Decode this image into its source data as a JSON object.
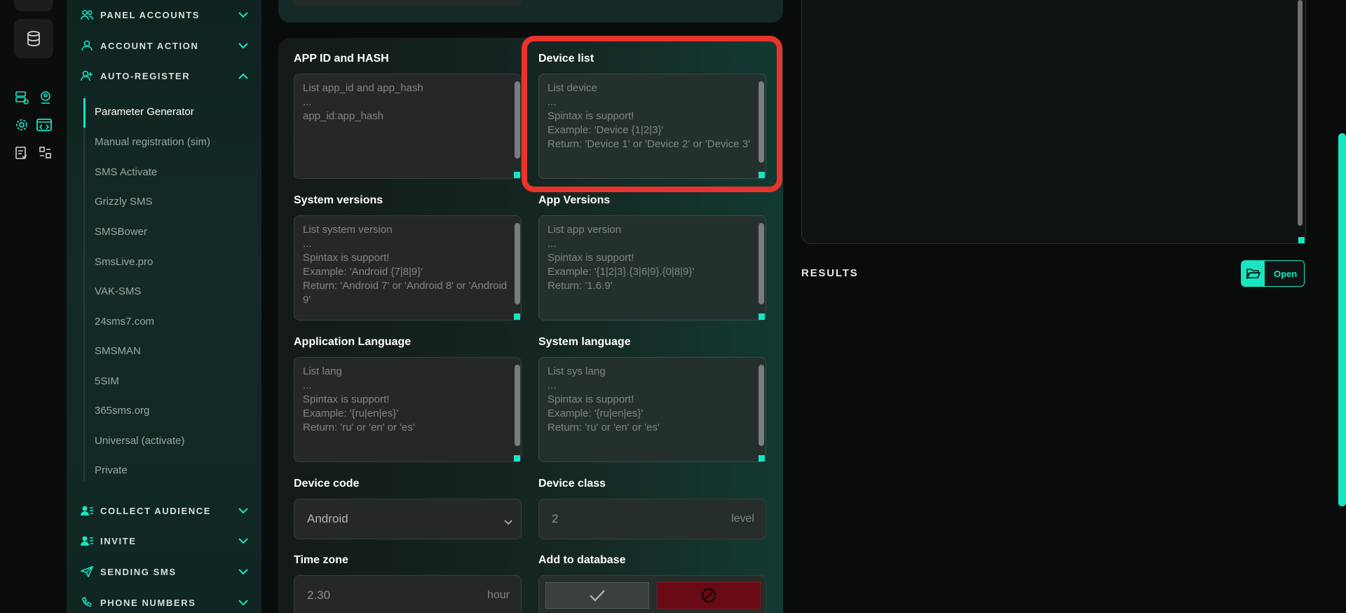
{
  "sidebar": {
    "sections": {
      "panel_accounts": "PANEL ACCOUNTS",
      "account_action": "ACCOUNT ACTION",
      "auto_register": "AUTO-REGISTER",
      "collect_audience": "COLLECT AUDIENCE",
      "invite": "INVITE",
      "sending_sms": "SENDING SMS",
      "phone_numbers": "PHONE NUMBERS"
    },
    "items": [
      "Parameter Generator",
      "Manual registration (sim)",
      "SMS Activate",
      "Grizzly SMS",
      "SMSBower",
      "SmsLive.pro",
      "VAK-SMS",
      "24sms7.com",
      "SMSMAN",
      "5SIM",
      "365sms.org",
      "Universal (activate)",
      "Private"
    ]
  },
  "form": {
    "app_id": {
      "label": "APP ID and HASH",
      "placeholder": "List app_id and app_hash\n...\napp_id:app_hash"
    },
    "device_list": {
      "label": "Device list",
      "placeholder": "List device\n...\nSpintax is support!\nExample: 'Device {1|2|3}'\nReturn: 'Device 1' or 'Device 2' or 'Device 3'"
    },
    "system_versions": {
      "label": "System versions",
      "placeholder": "List system version\n...\nSpintax is support!\nExample: 'Android {7|8|9}'\nReturn: 'Android 7' or 'Android 8' or 'Android 9'"
    },
    "app_versions": {
      "label": "App Versions",
      "placeholder": "List app version\n...\nSpintax is support!\nExample: '{1|2|3}.{3|6|9}.{0|8|9}'\nReturn: '1.6.9'"
    },
    "app_language": {
      "label": "Application Language",
      "placeholder": "List lang\n...\nSpintax is support!\nExample: '{ru|en|es}'\nReturn: 'ru' or 'en' or 'es'"
    },
    "system_language": {
      "label": "System language",
      "placeholder": "List sys lang\n...\nSpintax is support!\nExample: '{ru|en|es}'\nReturn: 'ru' or 'en' or 'es'"
    },
    "device_code": {
      "label": "Device code",
      "value": "Android"
    },
    "device_class": {
      "label": "Device class",
      "value": "2",
      "unit": "level"
    },
    "time_zone": {
      "label": "Time zone",
      "value": "2.30",
      "unit": "hour"
    },
    "add_to_database": {
      "label": "Add to database"
    }
  },
  "results": {
    "title": "RESULTS",
    "open_label": "Open"
  },
  "colors": {
    "accent": "#18e6c0",
    "highlight": "#e8342c",
    "danger": "#6a0a14"
  }
}
